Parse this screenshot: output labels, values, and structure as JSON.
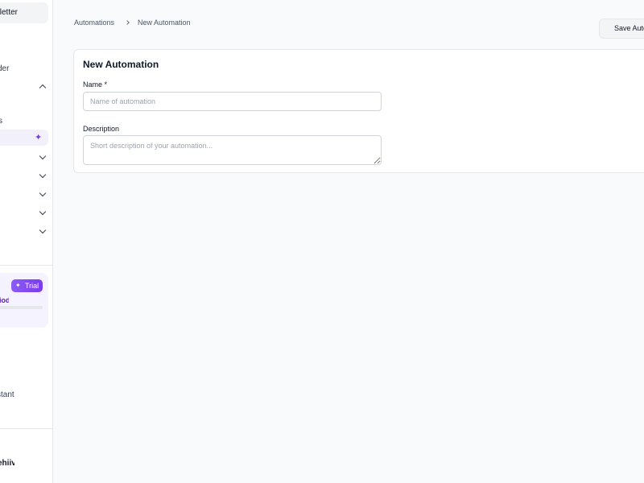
{
  "sidebar": {
    "newsletter_label": "letter",
    "section_label": "der",
    "group_label": "s",
    "trial": {
      "badge_label": "Trial",
      "period_label": "iod",
      "progress_fraction": 0.0
    },
    "assistant_label": "stant",
    "brand_label": "ehiiv"
  },
  "breadcrumb": {
    "root": "Automations",
    "current": "New Automation"
  },
  "toolbar": {
    "save_label": "Save Autor"
  },
  "form": {
    "title": "New Automation",
    "name": {
      "label": "Name *",
      "placeholder": "Name of automation",
      "value": ""
    },
    "description": {
      "label": "Description",
      "placeholder": "Short description of your automation...",
      "value": ""
    }
  },
  "colors": {
    "accent": "#7c3aed",
    "page_bg": "#f9fafb",
    "border": "#e5e7eb"
  }
}
